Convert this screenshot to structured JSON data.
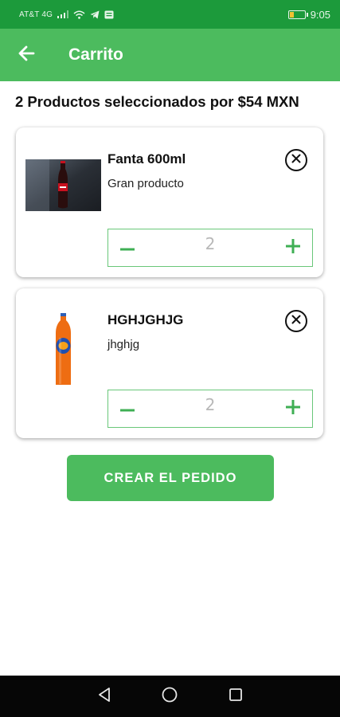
{
  "status_bar": {
    "carrier": "AT&T 4G",
    "time": "9:05",
    "icons": [
      "signal-icon",
      "wifi-icon",
      "telegram-icon",
      "notification-icon",
      "battery-icon"
    ]
  },
  "app_bar": {
    "title": "Carrito",
    "back_icon": "arrow-back-icon"
  },
  "summary": "2 Productos seleccionados por $54 MXN",
  "cart": {
    "items": [
      {
        "name": "Fanta 600ml",
        "description": "Gran producto",
        "quantity": "2",
        "image": "cola-bottle"
      },
      {
        "name": "HGHJGHJG",
        "description": "jhghjg",
        "quantity": "2",
        "image": "orange-soda-bottle"
      }
    ]
  },
  "create_order_label": "CREAR EL PEDIDO",
  "colors": {
    "status_bar": "#1c9a3b",
    "primary": "#4cbb5e",
    "stepper_border": "#69c779",
    "nav_bar": "#060606"
  },
  "nav": {
    "icons": [
      "back-triangle-icon",
      "home-circle-icon",
      "recents-square-icon"
    ]
  }
}
